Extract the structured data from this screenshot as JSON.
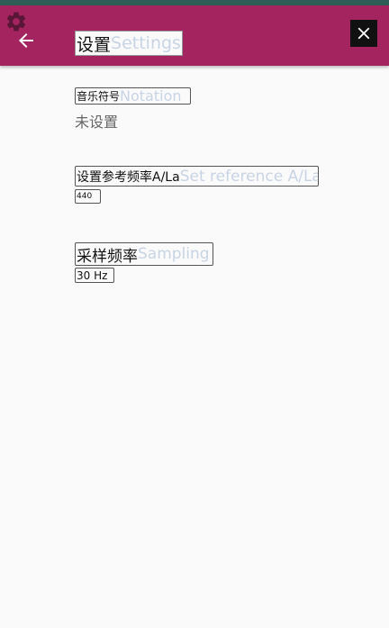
{
  "header": {
    "title": "设置",
    "title_ghost": "Settings",
    "back_icon": "arrow-left-icon",
    "close_icon": "close-icon",
    "gear_icon": "gear-icon"
  },
  "settings": {
    "notation": {
      "label": "音乐符号",
      "label_ghost": "Notation",
      "value": "未设置"
    },
    "reference": {
      "label": "设置参考频率A/La",
      "label_ghost": "Set reference A/La",
      "value": "440"
    },
    "sampling": {
      "label": "采样频率",
      "label_ghost": "Sampling frequency",
      "value": "30 Hz"
    }
  },
  "colors": {
    "appbar": "#A3245F",
    "statusbar": "#2E5E55",
    "background": "#FAFAFA"
  }
}
